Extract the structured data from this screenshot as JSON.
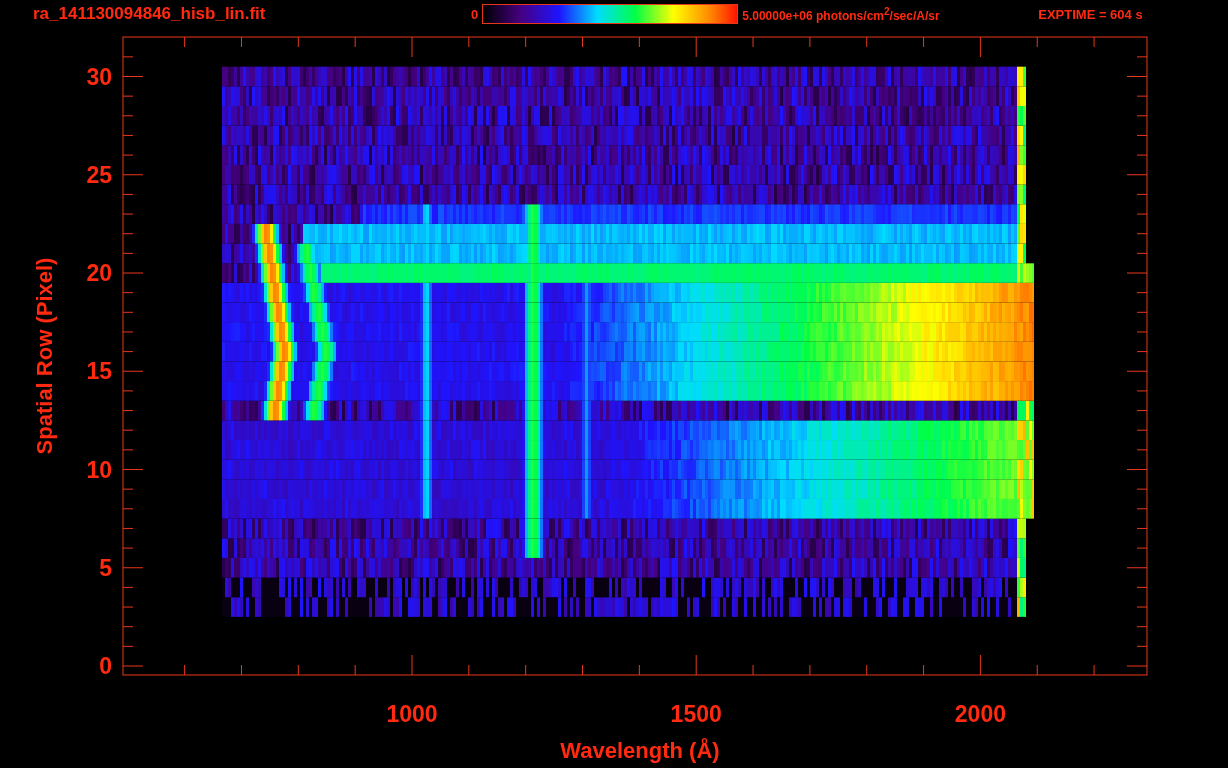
{
  "header": {
    "filename": "ra_141130094846_hisb_lin.fit",
    "colorbar": {
      "min_label": "0",
      "max_label": "5.00000e+06 photons/cm$^{2}$/sec/A/sr"
    },
    "exposure": "EXPTIME = 604 s"
  },
  "plot": {
    "y_axis": {
      "title": "Spatial Row (Pixel)",
      "ticks": [
        "30",
        "25",
        "20",
        "15",
        "10",
        "5",
        "0"
      ]
    },
    "x_axis": {
      "title": "Wavelength (Å)",
      "ticks": [
        "1000",
        "1500",
        "2000"
      ]
    }
  }
}
